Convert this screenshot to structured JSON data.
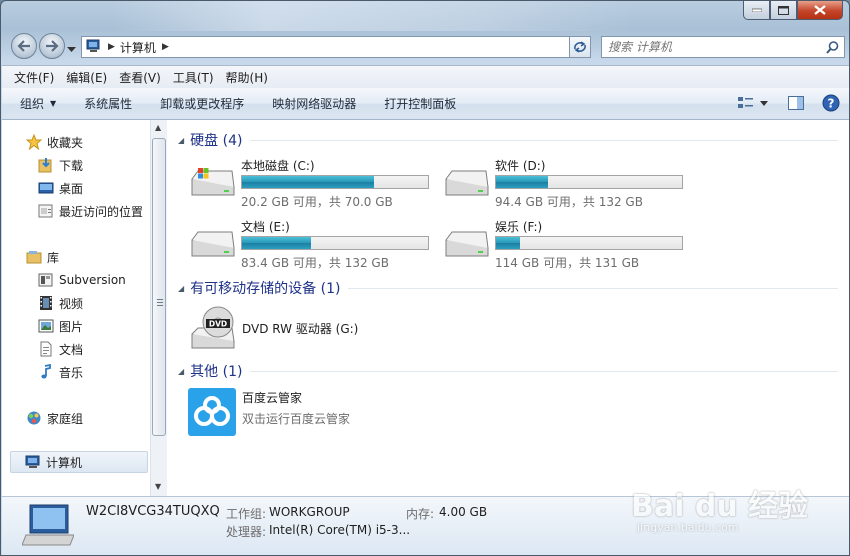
{
  "window": {
    "breadcrumb": "计算机",
    "search_placeholder": "搜索 计算机"
  },
  "menu": [
    "文件(F)",
    "编辑(E)",
    "查看(V)",
    "工具(T)",
    "帮助(H)"
  ],
  "toolbar": {
    "organize": "组织",
    "items": [
      "系统属性",
      "卸载或更改程序",
      "映射网络驱动器",
      "打开控制面板"
    ]
  },
  "nav": {
    "favorites_label": "收藏夹",
    "favorites": [
      "下载",
      "桌面",
      "最近访问的位置"
    ],
    "libraries_label": "库",
    "libraries": [
      "Subversion",
      "视频",
      "图片",
      "文档",
      "音乐"
    ],
    "homegroup": "家庭组",
    "computer": "计算机"
  },
  "sections": {
    "hdd": "硬盘 (4)",
    "removable": "有可移动存储的设备 (1)",
    "other": "其他 (1)"
  },
  "drives": [
    {
      "name": "本地磁盘 (C:)",
      "info": "20.2 GB 可用，共 70.0 GB",
      "used_fraction": 0.71
    },
    {
      "name": "软件 (D:)",
      "info": "94.4 GB 可用，共 132 GB",
      "used_fraction": 0.28
    },
    {
      "name": "文档 (E:)",
      "info": "83.4 GB 可用，共 132 GB",
      "used_fraction": 0.37
    },
    {
      "name": "娱乐 (F:)",
      "info": "114 GB 可用，共 131 GB",
      "used_fraction": 0.13
    }
  ],
  "dvd": {
    "name": "DVD RW 驱动器 (G:)",
    "icon_text": "DVD"
  },
  "baidu": {
    "name": "百度云管家",
    "desc": "双击运行百度云管家"
  },
  "details": {
    "pc_name": "W2CI8VCG34TUQXQ",
    "workgroup_label": "工作组:",
    "workgroup": "WORKGROUP",
    "memory_label": "内存:",
    "memory": "4.00 GB",
    "cpu_label": "处理器:",
    "cpu": "Intel(R) Core(TM) i5-3..."
  },
  "watermark": {
    "logo": "Bai du 经验",
    "url": "jingyan.baidu.com"
  },
  "colors": {
    "accent": "#1e3287",
    "bar_fill": "#2897b8",
    "link_blue": "#1e3287"
  }
}
